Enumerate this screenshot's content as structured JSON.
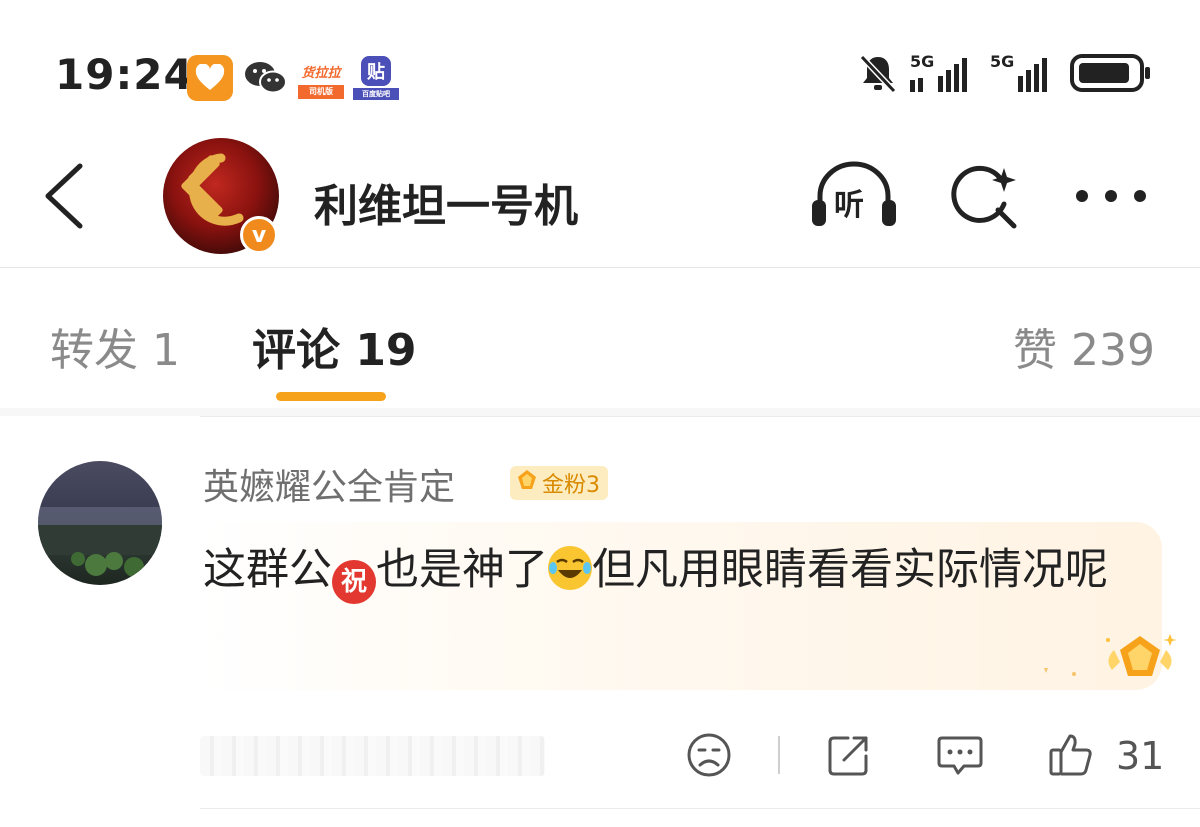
{
  "status_bar": {
    "time": "19:24",
    "apps": [
      {
        "name": "heart-app",
        "color": "#f4961f"
      },
      {
        "name": "wechat",
        "color": "#333333"
      },
      {
        "name": "huolala",
        "label": "货拉拉",
        "sub": "司机版",
        "color": "#f26a2e"
      },
      {
        "name": "tieba",
        "label": "贴",
        "sub": "百度贴吧",
        "color": "#4b4fb8"
      }
    ],
    "network_1": "5G",
    "network_2": "5G",
    "icons": [
      "bell-off-icon",
      "signal-icon",
      "battery-icon"
    ]
  },
  "header": {
    "title": "利维坦一号机",
    "verified_mark": "v",
    "icons": [
      "back-icon",
      "listen-icon",
      "search-icon",
      "more-icon"
    ],
    "listen_label": "听"
  },
  "tabs": {
    "repost": "转发 1",
    "comment": "评论 19",
    "likes": "赞 239",
    "accent": "#f7a21b"
  },
  "comment": {
    "username": "英嬷耀公全肯定",
    "fan_badge": "金粉3",
    "text_part1": "这群公",
    "emoji_1": "祝",
    "text_part2": "也是神了",
    "emoji_2": "😂",
    "text_part3": "但凡用眼睛看看实际情况呢",
    "like_count": "31",
    "actions": [
      "sad-face-icon",
      "share-icon",
      "reply-icon",
      "thumbs-up-icon"
    ]
  }
}
